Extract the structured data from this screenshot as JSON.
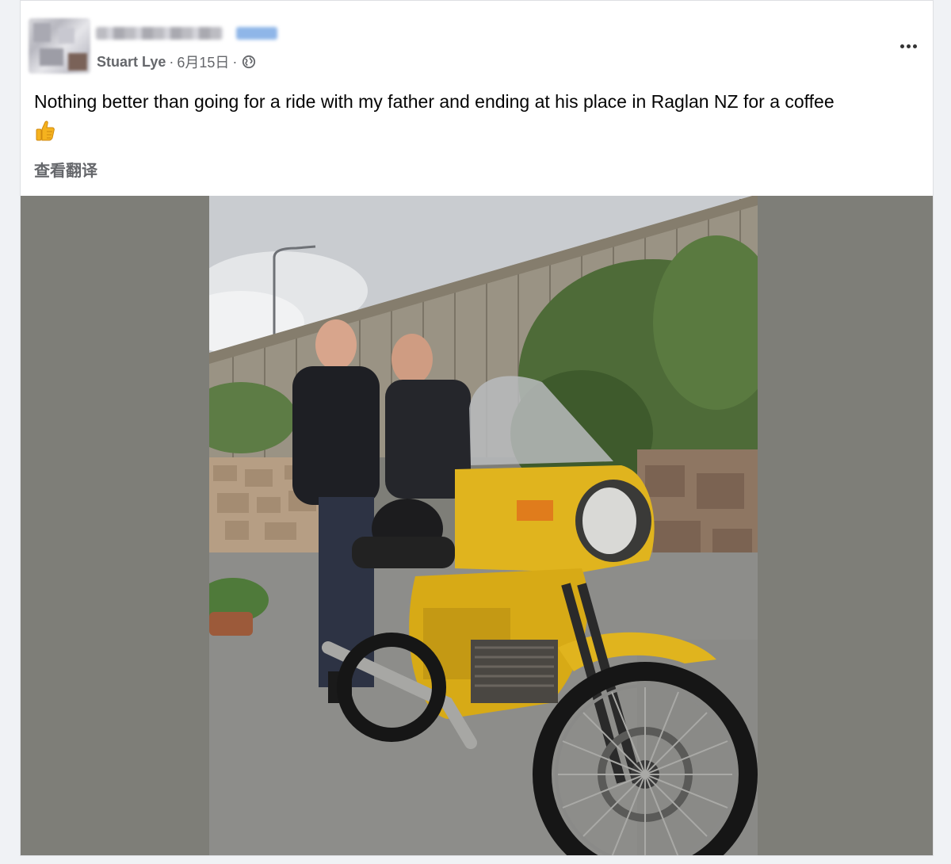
{
  "post": {
    "author_name": "Stuart Lye",
    "date_separator": "·",
    "date": "6月15日",
    "date_trailing_separator": "·",
    "privacy_icon": "globe-icon",
    "text": "Nothing better than going for a ride with my father and ending at his place in Raglan NZ for a coffee",
    "emoji": "thumbs-up-icon",
    "translate_label": "查看翻译",
    "more_icon": "more-options-icon"
  },
  "photo": {
    "subject": "two men standing beside a yellow motorcycle"
  },
  "colors": {
    "background": "#f0f2f5",
    "card": "#ffffff",
    "secondary_text": "#65676b",
    "primary_text": "#050505",
    "photo_letterbox": "#7e7e78",
    "motorcycle_yellow": "#e0b41e"
  }
}
